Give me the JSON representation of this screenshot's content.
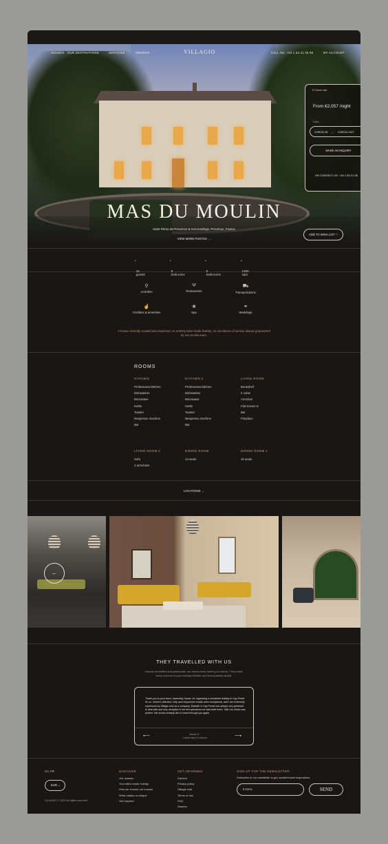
{
  "nav": {
    "logo": "VILLAGIO",
    "left_items": [
      "HOUSES",
      "OUR DESTINATIONS",
      "SERVICES",
      "OWNERS"
    ],
    "contact": "CALL US: +33 1 53 21 05 05",
    "account": "MY ACCOUNT"
  },
  "hero": {
    "title": "MAS DU MOULIN",
    "subtitle": "Saint Rémy-de-Provence & surroundings, Provence, France",
    "view_photos": "VIEW MORE PHOTOS",
    "wishlist": "ADD TO WISH LIST"
  },
  "booking": {
    "currency": "€ Check rate",
    "price": "From €2,057 /night",
    "dates_label": "Dates",
    "check_in": "CHECK-IN",
    "check_out": "CHECK-OUT",
    "inquiry": "MAKE AN INQUIRY",
    "contact": "OR CONTACT US: +33 1 53 21 05"
  },
  "stats": [
    "16 guests",
    "8 bedrooms",
    "9 bathrooms",
    "1200 sqm"
  ],
  "amenities": [
    {
      "label": "Activities",
      "icon": "bicycle-icon",
      "glyph": "⚲"
    },
    {
      "label": "Restaurants",
      "icon": "cutlery-icon",
      "glyph": "Ψ"
    },
    {
      "label": "Transportations",
      "icon": "car-icon",
      "glyph": "⛟"
    },
    {
      "label": "Facilities & amenities",
      "icon": "hand-icon",
      "glyph": "☝"
    },
    {
      "label": "Spa",
      "icon": "lotus-icon",
      "glyph": "❀"
    },
    {
      "label": "Weddings",
      "icon": "rings-icon",
      "glyph": "⚭"
    }
  ],
  "tagline": "A house carefully curated and inspected. An entirely tailor-made holiday. An excellence of service always guaranteed by our on-site team.",
  "rooms": {
    "title": "ROOMS",
    "groups": [
      {
        "name": "KITCHEN",
        "items": [
          "Professional kitchen",
          "Dishwasher",
          "Microwave",
          "Kettle",
          "Toaster",
          "Nespresso machine",
          "Bar"
        ]
      },
      {
        "name": "KITCHEN 2",
        "items": [
          "Professional kitchen",
          "Dishwasher",
          "Microwave",
          "Kettle",
          "Toaster",
          "Nespresso machine",
          "Bar"
        ]
      },
      {
        "name": "LIVING ROOM",
        "items": [
          "Bookshelf",
          "2 sofas",
          "Armchair",
          "Flat screen tv",
          "Bar",
          "Fireplace"
        ]
      },
      {
        "name": "LIVING ROOM 2",
        "items": [
          "Sofa",
          "4 armchairs"
        ]
      },
      {
        "name": "DINING ROOM",
        "items": [
          "14 seats"
        ]
      },
      {
        "name": "DINING ROOM 2",
        "items": [
          "16 seats"
        ]
      }
    ]
  },
  "locations": "LOCATIONS",
  "testimonials": {
    "title": "THEY TRAVELLED WITH US",
    "subtitle": "Deeply committed and passionate, our teams leave nothing to chance. They make every moment of your holidays flexible and incomparably simple.",
    "quote": "Thank you to your team, especially Xavier, for organizing a wonderful holiday in Cap Ferret for us. Xavier's attention, help and responsive emails were exceptional, and I am extremely impressed by Villagio club as a company. Marielle in Cap Ferret was always very pleasant to deal with and very receptive to the few questions we had while there. Villa Les Gines was perfect. We would certainly like to travel through you again.",
    "author": "Nicolle D.",
    "stay": "1 week stay in Luberon"
  },
  "footer": {
    "lang_en": "EN",
    "lang_fr": "FR",
    "currency": "EUR",
    "copyright": "VILLAGIO © 2023 All rights reserved",
    "discover": {
      "title": "DISCOVER",
      "links": [
        "Our mission",
        "Your tailor-made holiday",
        "How we choose our houses",
        "What makes us unique",
        "Get inspired"
      ]
    },
    "informed": {
      "title": "GET INFORMED",
      "links": [
        "Careers",
        "Privacy policy",
        "Villagio club",
        "Terms of use",
        "FAQ",
        "Owners"
      ]
    },
    "newsletter": {
      "title": "SIGN UP FOR THE NEWSLETTER",
      "subtitle": "Subscribe to our newsletter to get curated travel inspirations.",
      "placeholder": "E-MAIL",
      "send": "SEND"
    }
  },
  "colors": {
    "background": "#1a1616",
    "accent": "#c7a46a",
    "frame": "#9a9a98"
  }
}
